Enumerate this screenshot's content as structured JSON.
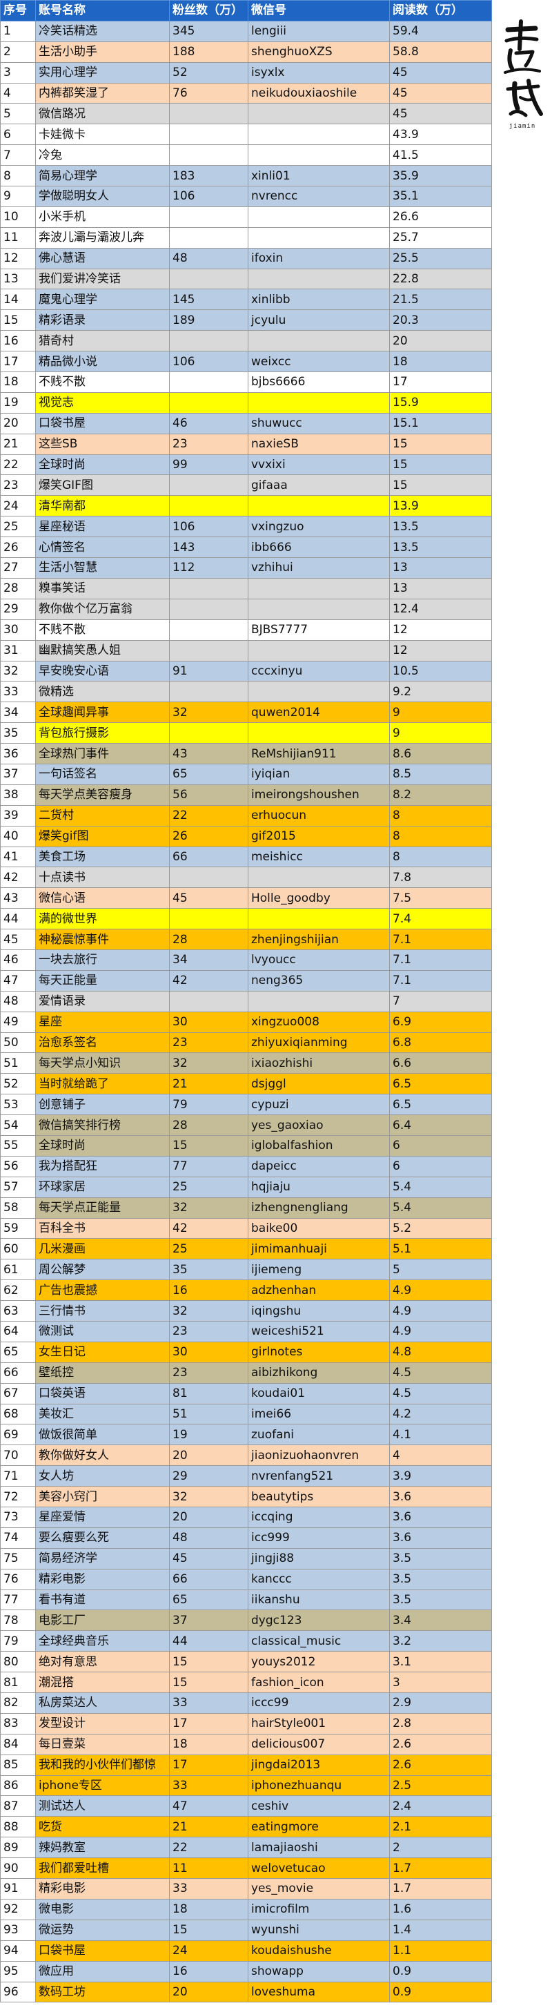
{
  "columns": [
    "序号",
    "账号名称",
    "粉丝数（万）",
    "微信号",
    "阅读数（万）"
  ],
  "logo": {
    "caption": "jiamin"
  },
  "palette": {
    "blue": "#b8cce4",
    "peach": "#fcd5b4",
    "gray": "#d9d9d9",
    "white": "#ffffff",
    "yellow": "#ffff00",
    "orange": "#ffc000",
    "tan": "#c4bd97",
    "header": "#1f66c4"
  },
  "rows": [
    [
      "1",
      "冷笑话精选",
      "345",
      "lengiii",
      "59.4",
      "blue"
    ],
    [
      "2",
      "生活小助手",
      "188",
      "shenghuoXZS",
      "58.8",
      "peach"
    ],
    [
      "3",
      "实用心理学",
      "52",
      "isyxlx",
      "45",
      "blue"
    ],
    [
      "4",
      "内裤都笑湿了",
      "76",
      "neikudouxiaoshile",
      "45",
      "peach"
    ],
    [
      "5",
      "微信路况",
      "",
      "",
      "45",
      "gray"
    ],
    [
      "6",
      "卡娃微卡",
      "",
      "",
      "43.9",
      "white"
    ],
    [
      "7",
      "冷兔",
      "",
      "",
      "41.5",
      "white"
    ],
    [
      "8",
      "简易心理学",
      "183",
      "xinli01",
      "35.9",
      "blue"
    ],
    [
      "9",
      "学做聪明女人",
      "106",
      "nvrencc",
      "35.1",
      "blue"
    ],
    [
      "10",
      "小米手机",
      "",
      "",
      "26.6",
      "white"
    ],
    [
      "11",
      "奔波儿灞与灞波儿奔",
      "",
      "",
      "25.7",
      "white"
    ],
    [
      "12",
      "佛心慧语",
      "48",
      "ifoxin",
      "25.5",
      "blue"
    ],
    [
      "13",
      "我们爱讲冷笑话",
      "",
      "",
      "22.8",
      "gray"
    ],
    [
      "14",
      "魔鬼心理学",
      "145",
      "xinlibb",
      "21.5",
      "blue"
    ],
    [
      "15",
      "精彩语录",
      "189",
      "jcyulu",
      "20.3",
      "blue"
    ],
    [
      "16",
      "猎奇村",
      "",
      "",
      "20",
      "gray"
    ],
    [
      "17",
      "精品微小说",
      "106",
      "weixcc",
      "18",
      "blue"
    ],
    [
      "18",
      "不贱不散",
      "",
      "bjbs6666",
      "17",
      "white"
    ],
    [
      "19",
      "视觉志",
      "",
      "",
      "15.9",
      "yellow"
    ],
    [
      "20",
      "口袋书屋",
      "46",
      "shuwucc",
      "15.1",
      "blue"
    ],
    [
      "21",
      "这些SB",
      "23",
      "naxieSB",
      "15",
      "peach"
    ],
    [
      "22",
      "全球时尚",
      "99",
      "vvxixi",
      "15",
      "blue"
    ],
    [
      "23",
      "爆笑GIF图",
      "",
      "gifaaa",
      "15",
      "gray"
    ],
    [
      "24",
      "清华南都",
      "",
      "",
      "13.9",
      "yellow"
    ],
    [
      "25",
      "星座秘语",
      "106",
      "vxingzuo",
      "13.5",
      "blue"
    ],
    [
      "26",
      "心情签名",
      "143",
      "ibb666",
      "13.5",
      "blue"
    ],
    [
      "27",
      "生活小智慧",
      "112",
      "vzhihui",
      "13",
      "blue"
    ],
    [
      "28",
      "糗事笑话",
      "",
      "",
      "13",
      "gray"
    ],
    [
      "29",
      "教你做个亿万富翁",
      "",
      "",
      "12.4",
      "gray"
    ],
    [
      "30",
      "不贱不散",
      "",
      "BJBS7777",
      "12",
      "white"
    ],
    [
      "31",
      "幽默搞笑愚人姐",
      "",
      "",
      "12",
      "gray"
    ],
    [
      "32",
      "早安晚安心语",
      "91",
      "cccxinyu",
      "10.5",
      "blue"
    ],
    [
      "33",
      "微精选",
      "",
      "",
      "9.2",
      "gray"
    ],
    [
      "34",
      "全球趣闻异事",
      "32",
      "quwen2014",
      "9",
      "orange"
    ],
    [
      "35",
      "背包旅行摄影",
      "",
      "",
      "9",
      "yellow"
    ],
    [
      "36",
      "全球热门事件",
      "43",
      "ReMshijian911",
      "8.6",
      "tan"
    ],
    [
      "37",
      "一句话签名",
      "65",
      "iyiqian",
      "8.5",
      "blue"
    ],
    [
      "38",
      "每天学点美容瘦身",
      "56",
      "imeirongshoushen",
      "8.2",
      "tan"
    ],
    [
      "39",
      "二货村",
      "22",
      "erhuocun",
      "8",
      "orange"
    ],
    [
      "40",
      "爆笑gif图",
      "26",
      "gif2015",
      "8",
      "orange"
    ],
    [
      "41",
      "美食工场",
      "66",
      "meishicc",
      "8",
      "blue"
    ],
    [
      "42",
      "十点读书",
      "",
      "",
      "7.8",
      "gray"
    ],
    [
      "43",
      "微信心语",
      "45",
      "Holle_goodby",
      "7.5",
      "peach"
    ],
    [
      "44",
      "满的微世界",
      "",
      "",
      "7.4",
      "yellow"
    ],
    [
      "45",
      "神秘震惊事件",
      "28",
      "zhenjingshijian",
      "7.1",
      "orange"
    ],
    [
      "46",
      "一块去旅行",
      "34",
      "lvyoucc",
      "7.1",
      "blue"
    ],
    [
      "47",
      "每天正能量",
      "42",
      "neng365",
      "7.1",
      "blue"
    ],
    [
      "48",
      "爱情语录",
      "",
      "",
      "7",
      "gray"
    ],
    [
      "49",
      "星座",
      "30",
      "xingzuo008",
      "6.9",
      "orange"
    ],
    [
      "50",
      "治愈系签名",
      "23",
      "zhiyuxiqianming",
      "6.8",
      "orange"
    ],
    [
      "51",
      "每天学点小知识",
      "32",
      "ixiaozhishi",
      "6.6",
      "tan"
    ],
    [
      "52",
      "当时就给跪了",
      "21",
      "dsjggl",
      "6.5",
      "orange"
    ],
    [
      "53",
      "创意铺子",
      "79",
      "cypuzi",
      "6.5",
      "blue"
    ],
    [
      "54",
      "微信搞笑排行榜",
      "28",
      "yes_gaoxiao",
      "6.4",
      "tan"
    ],
    [
      "55",
      "全球时尚",
      "15",
      "iglobalfashion",
      "6",
      "tan"
    ],
    [
      "56",
      "我为搭配狂",
      "77",
      "dapeicc",
      "6",
      "blue"
    ],
    [
      "57",
      "环球家居",
      "25",
      "hqjiaju",
      "5.4",
      "blue"
    ],
    [
      "58",
      "每天学点正能量",
      "32",
      "izhengnengliang",
      "5.4",
      "tan"
    ],
    [
      "59",
      "百科全书",
      "42",
      "baike00",
      "5.2",
      "peach"
    ],
    [
      "60",
      "几米漫画",
      "25",
      "jimimanhuaji",
      "5.1",
      "orange"
    ],
    [
      "61",
      "周公解梦",
      "35",
      "ijiemeng",
      "5",
      "blue"
    ],
    [
      "62",
      "广告也震撼",
      "16",
      "adzhenhan",
      "4.9",
      "orange"
    ],
    [
      "63",
      "三行情书",
      "32",
      "iqingshu",
      "4.9",
      "blue"
    ],
    [
      "64",
      "微测试",
      "23",
      "weiceshi521",
      "4.9",
      "blue"
    ],
    [
      "65",
      "女生日记",
      "30",
      "girlnotes",
      "4.8",
      "orange"
    ],
    [
      "66",
      "壁纸控",
      "23",
      "aibizhikong",
      "4.5",
      "tan"
    ],
    [
      "67",
      "口袋英语",
      "81",
      "koudai01",
      "4.5",
      "blue"
    ],
    [
      "68",
      "美妆汇",
      "51",
      "imei66",
      "4.2",
      "blue"
    ],
    [
      "69",
      "做饭很简单",
      "19",
      "zuofani",
      "4.1",
      "blue"
    ],
    [
      "70",
      "教你做好女人",
      "20",
      "jiaonizuohaonvren",
      "4",
      "peach"
    ],
    [
      "71",
      "女人坊",
      "29",
      "nvrenfang521",
      "3.9",
      "blue"
    ],
    [
      "72",
      "美容小窍门",
      "32",
      "beautytips",
      "3.6",
      "peach"
    ],
    [
      "73",
      "星座爱情",
      "20",
      "iccqing",
      "3.6",
      "blue"
    ],
    [
      "74",
      "要么瘦要么死",
      "48",
      "icc999",
      "3.6",
      "blue"
    ],
    [
      "75",
      "简易经济学",
      "45",
      "jingji88",
      "3.5",
      "blue"
    ],
    [
      "76",
      "精彩电影",
      "66",
      "kanccc",
      "3.5",
      "blue"
    ],
    [
      "77",
      "看书有道",
      "65",
      "iikanshu",
      "3.5",
      "blue"
    ],
    [
      "78",
      "电影工厂",
      "37",
      "dygc123",
      "3.4",
      "tan"
    ],
    [
      "79",
      "全球经典音乐",
      "44",
      "classical_music",
      "3.2",
      "blue"
    ],
    [
      "80",
      "绝对有意思",
      "15",
      "youys2012",
      "3.1",
      "peach"
    ],
    [
      "81",
      "潮混搭",
      "15",
      "fashion_icon",
      "3",
      "peach"
    ],
    [
      "82",
      "私房菜达人",
      "33",
      "iccc99",
      "2.9",
      "blue"
    ],
    [
      "83",
      "发型设计",
      "17",
      "hairStyle001",
      "2.8",
      "peach"
    ],
    [
      "84",
      "每日壹菜",
      "18",
      "delicious007",
      "2.6",
      "peach"
    ],
    [
      "85",
      "我和我的小伙伴们都惊",
      "17",
      "jingdai2013",
      "2.6",
      "orange"
    ],
    [
      "86",
      "iphone专区",
      "33",
      "iphonezhuanqu",
      "2.5",
      "orange"
    ],
    [
      "87",
      "测试达人",
      "47",
      "ceshiv",
      "2.4",
      "blue"
    ],
    [
      "88",
      "吃货",
      "21",
      "eatingmore",
      "2.1",
      "orange"
    ],
    [
      "89",
      "辣妈教室",
      "22",
      "lamajiaoshi",
      "2",
      "blue"
    ],
    [
      "90",
      "我们都爱吐槽",
      "11",
      "welovetucao",
      "1.7",
      "orange"
    ],
    [
      "91",
      "精彩电影",
      "33",
      "yes_movie",
      "1.7",
      "peach"
    ],
    [
      "92",
      "微电影",
      "18",
      "imicrofilm",
      "1.6",
      "blue"
    ],
    [
      "93",
      "微运势",
      "15",
      "wyunshi",
      "1.4",
      "blue"
    ],
    [
      "94",
      "口袋书屋",
      "24",
      "koudaishushe",
      "1.1",
      "orange"
    ],
    [
      "95",
      "微应用",
      "16",
      "showapp",
      "0.9",
      "blue"
    ],
    [
      "96",
      "数码工坊",
      "20",
      "loveshuma",
      "0.9",
      "orange"
    ]
  ]
}
